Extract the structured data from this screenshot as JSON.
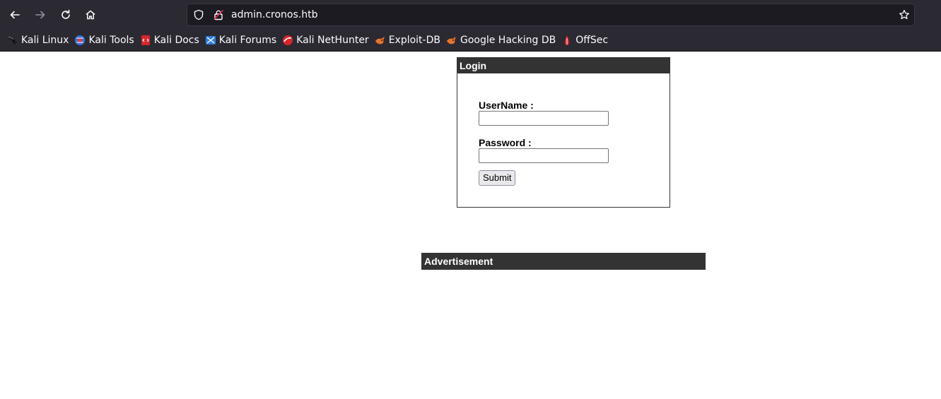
{
  "browser": {
    "url": "admin.cronos.htb",
    "bookmarks": [
      {
        "label": "Kali Linux",
        "icon": "kali-dragon-icon"
      },
      {
        "label": "Kali Tools",
        "icon": "kali-tools-icon"
      },
      {
        "label": "Kali Docs",
        "icon": "kali-docs-icon"
      },
      {
        "label": "Kali Forums",
        "icon": "kali-forums-icon"
      },
      {
        "label": "Kali NetHunter",
        "icon": "kali-nethunter-icon"
      },
      {
        "label": "Exploit-DB",
        "icon": "exploit-db-icon"
      },
      {
        "label": "Google Hacking DB",
        "icon": "ghdb-icon"
      },
      {
        "label": "OffSec",
        "icon": "offsec-icon"
      }
    ]
  },
  "login": {
    "title": "Login",
    "username_label": "UserName :",
    "username_value": "",
    "password_label": "Password :",
    "password_value": "",
    "submit_label": "Submit"
  },
  "advertisement": {
    "title": "Advertisement"
  },
  "colors": {
    "chrome_bg": "#2b2a33",
    "header_bg": "#333333"
  }
}
